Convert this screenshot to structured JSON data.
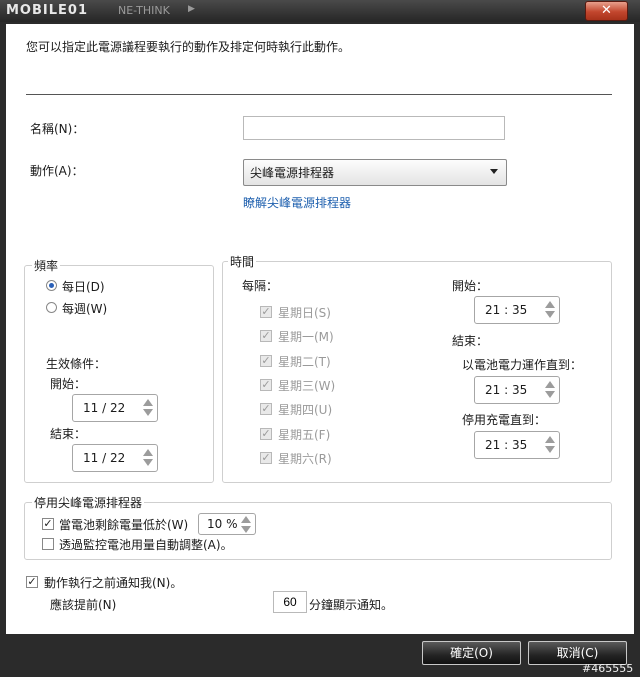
{
  "titlebar": {
    "logo": "MOBILE01",
    "ghost_title": "NE-THINK",
    "close_label": "✕"
  },
  "intro": "您可以指定此電源議程要執行的動作及排定何時執行此動作。",
  "name_field": {
    "label": "名稱(N)：",
    "value": ""
  },
  "action_field": {
    "label": "動作(A)：",
    "selected": "尖峰電源排程器"
  },
  "learn_link": "瞭解尖峰電源排程器",
  "frequency": {
    "title": "頻率",
    "daily": "每日(D)",
    "weekly": "每週(W)",
    "selected": "daily",
    "effective_title": "生效條件：",
    "start_label": "開始：",
    "start_value": "11 / 22",
    "end_label": "結束：",
    "end_value": "11 / 22"
  },
  "time": {
    "title": "時間",
    "every_label": "每隔：",
    "days": [
      "星期日(S)",
      "星期一(M)",
      "星期二(T)",
      "星期三(W)",
      "星期四(U)",
      "星期五(F)",
      "星期六(R)"
    ],
    "start_label": "開始：",
    "start_value": "21 : 35",
    "end_label": "結束：",
    "battery_label": "以電池電力運作直到：",
    "battery_value": "21 : 35",
    "charge_label": "停用充電直到：",
    "charge_value": "21 : 35"
  },
  "disable_group": {
    "title": "停用尖峰電源排程器",
    "low_battery_label": "當電池剩餘電量低於(W)",
    "low_battery_checked": true,
    "low_battery_value": "10 %",
    "auto_adjust_label": "透過監控電池用量自動調整(A)。",
    "auto_adjust_checked": false
  },
  "notify": {
    "label": "動作執行之前通知我(N)。",
    "checked": true,
    "advance_label": "應該提前(N)",
    "minutes_value": "60",
    "suffix": "分鐘顯示通知。"
  },
  "buttons": {
    "ok": "確定(O)",
    "cancel": "取消(C)"
  },
  "watermark": "#465555"
}
